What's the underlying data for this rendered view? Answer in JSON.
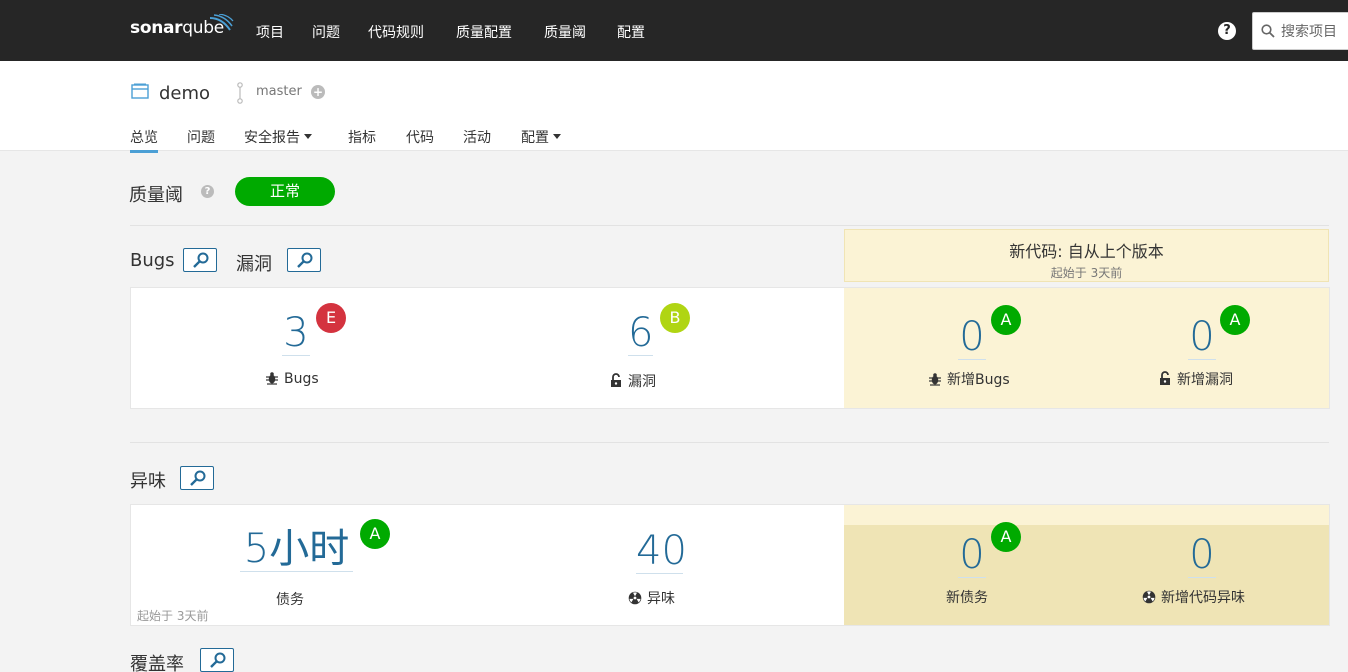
{
  "nav": {
    "logo_a": "sonar",
    "logo_b": "qube",
    "items": [
      "项目",
      "问题",
      "代码规则",
      "质量配置",
      "质量阈",
      "配置"
    ],
    "search_placeholder": "搜索项目"
  },
  "project": {
    "name": "demo",
    "branch": "master",
    "tabs": [
      "总览",
      "问题",
      "安全报告",
      "指标",
      "代码",
      "活动",
      "配置"
    ],
    "active_tab": "总览"
  },
  "quality_gate": {
    "label": "质量阈",
    "status": "正常",
    "status_color": "#00aa00"
  },
  "reliability": {
    "title_bugs": "Bugs",
    "title_vuln": "漏洞",
    "bugs_value": "3",
    "bugs_rating": "E",
    "bugs_label": "Bugs",
    "vuln_value": "6",
    "vuln_rating": "B",
    "vuln_label": "漏洞"
  },
  "new_code": {
    "title": "新代码: 自从上个版本",
    "since": "起始于 3天前",
    "new_bugs_value": "0",
    "new_bugs_rating": "A",
    "new_bugs_label": "新增Bugs",
    "new_vuln_value": "0",
    "new_vuln_rating": "A",
    "new_vuln_label": "新增漏洞"
  },
  "maintainability": {
    "title": "异味",
    "debt_value": "5小时",
    "debt_rating": "A",
    "debt_label": "债务",
    "smells_value": "40",
    "smells_label": "异味",
    "since": "起始于 3天前",
    "new_debt_value": "0",
    "new_debt_rating": "A",
    "new_debt_label": "新债务",
    "new_smells_value": "0",
    "new_smells_label": "新增代码异味"
  },
  "coverage": {
    "title": "覆盖率"
  },
  "colors": {
    "rating_A": "#00aa00",
    "rating_B": "#b0d513",
    "rating_E": "#d4333f",
    "link_blue": "#236a97",
    "new_code_bg": "#fbf3d5"
  }
}
